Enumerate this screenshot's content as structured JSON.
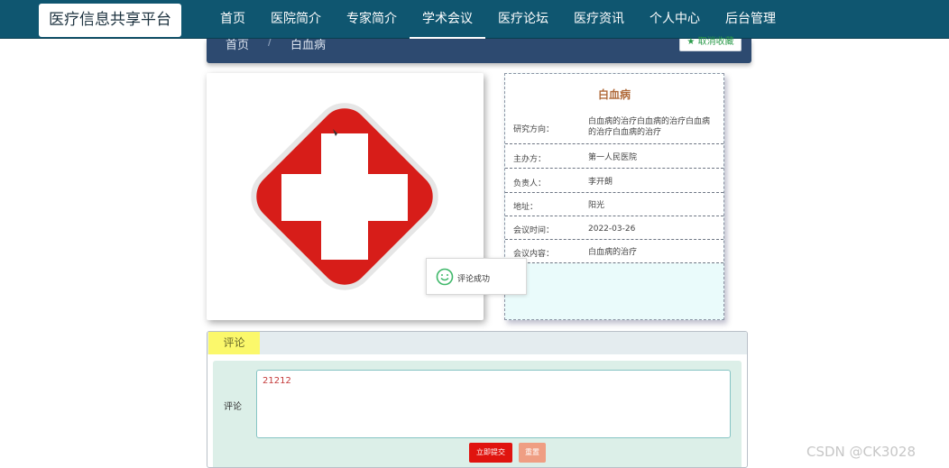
{
  "logo": "医疗信息共享平台",
  "nav": [
    "首页",
    "医院简介",
    "专家简介",
    "学术会议",
    "医疗论坛",
    "医疗资讯",
    "个人中心",
    "后台管理"
  ],
  "nav_active_index": 3,
  "breadcrumb": {
    "home": "首页",
    "sep": "/",
    "current": "白血病"
  },
  "favorite_button": "★ 取消收藏",
  "info": {
    "title": "白血病",
    "rows": [
      {
        "label": "研究方向：",
        "value": "白血病的治疗白血病的治疗白血病的治疗白血病的治疗"
      },
      {
        "label": "主办方：",
        "value": "第一人民医院"
      },
      {
        "label": "负责人：",
        "value": "李开朗"
      },
      {
        "label": "地址：",
        "value": "阳光"
      },
      {
        "label": "会议时间：",
        "value": "2022-03-26"
      },
      {
        "label": "会议内容：",
        "value": "白血病的治疗"
      }
    ]
  },
  "toast": {
    "icon": "smile-icon",
    "text": "评论成功"
  },
  "comment": {
    "tab": "评论",
    "label": "评论",
    "value": "21212",
    "submit": "立即提交",
    "reset": "重置"
  },
  "watermark": "CSDN @CK3028",
  "colors": {
    "topbar": "#0f5670",
    "crumbbar": "#2d4a70",
    "cross": "#d71d19",
    "submit": "#e0140f",
    "reset": "#ef9e83",
    "tab": "#fbf86b"
  }
}
